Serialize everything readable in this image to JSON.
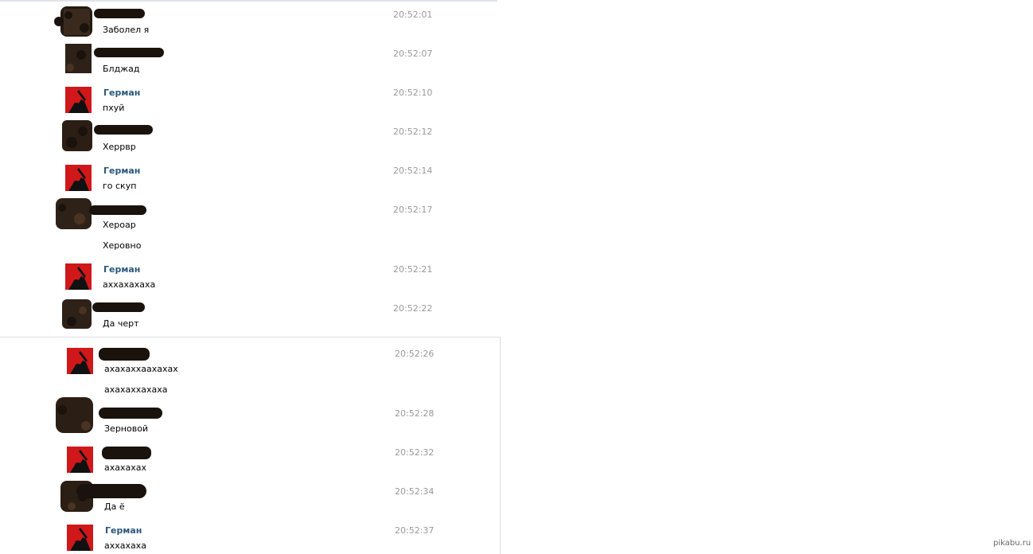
{
  "colors": {
    "accent_name": "#2b587a",
    "time": "#999999",
    "avatar_red": "#d0181a",
    "scribble": "#1a120c"
  },
  "known_sender": {
    "name": "Герман",
    "avatar": "red-background-black-silhouette-avatar"
  },
  "messages": [
    {
      "time": "20:52:01",
      "texts": [
        "Заболел я"
      ],
      "sender": "redacted"
    },
    {
      "time": "20:52:07",
      "texts": [
        "Блджад"
      ],
      "sender": "redacted"
    },
    {
      "time": "20:52:10",
      "texts": [
        "пхуй"
      ],
      "sender": "Герман"
    },
    {
      "time": "20:52:12",
      "texts": [
        "Херрвр"
      ],
      "sender": "redacted"
    },
    {
      "time": "20:52:14",
      "texts": [
        "го скуп"
      ],
      "sender": "Герман"
    },
    {
      "time": "20:52:17",
      "texts": [
        "Хероар",
        "Херовно"
      ],
      "sender": "redacted"
    },
    {
      "time": "20:52:21",
      "texts": [
        "аххахахаха"
      ],
      "sender": "Герман"
    },
    {
      "time": "20:52:22",
      "texts": [
        "Да черт"
      ],
      "sender": "redacted"
    },
    {
      "time": "20:52:26",
      "texts": [
        "ахахаххаахахах",
        "ахахаххахаха"
      ],
      "sender": "Герман-redacted"
    },
    {
      "time": "20:52:28",
      "texts": [
        "Зерновой"
      ],
      "sender": "redacted"
    },
    {
      "time": "20:52:32",
      "texts": [
        "ахахахах"
      ],
      "sender": "Герман-redacted"
    },
    {
      "time": "20:52:34",
      "texts": [
        "Да ё"
      ],
      "sender": "redacted"
    },
    {
      "time": "20:52:37",
      "texts": [
        "аххахаха"
      ],
      "sender": "Герман"
    }
  ],
  "watermark": "pikabu.ru"
}
